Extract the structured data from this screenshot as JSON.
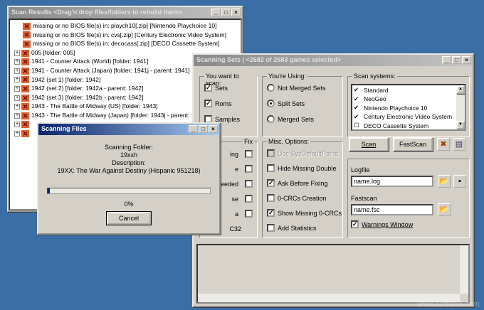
{
  "scan_results": {
    "title": "Scan Results <Drag'n'drop files/folders to rebuild them>",
    "rows": [
      {
        "text": "missing or no BIOS file(s) in: playch10[.zip] [Nintendo Playchoice 10]",
        "child": true
      },
      {
        "text": "missing or no BIOS file(s) in: cvs[.zip] [Century Electronic Video System]",
        "child": true
      },
      {
        "text": "missing or no BIOS file(s) in: decocass[.zip] [DECO Cassette System]",
        "child": true
      },
      {
        "text": "005 [folder: 005]",
        "child": false
      },
      {
        "text": "1941 - Counter Attack (World) [folder: 1941]",
        "child": false
      },
      {
        "text": "1941 - Counter Attack (Japan) [folder: 1941j - parent: 1941]",
        "child": false
      },
      {
        "text": "1942 (set 1) [folder: 1942]",
        "child": false
      },
      {
        "text": "1942 (set 2) [folder: 1942a - parent: 1942]",
        "child": false
      },
      {
        "text": "1942 (set 3) [folder: 1942b - parent: 1942]",
        "child": false
      },
      {
        "text": "1943 - The Battle of Midway (US) [folder: 1943]",
        "child": false
      },
      {
        "text": "1943 - The Battle of Midway (Japan) [folder: 1943j - parent: 1943]",
        "child": false
      }
    ]
  },
  "scanning_sets": {
    "title": "Scanning Sets | <2682 of 2683 games selected>",
    "want_label": "You want to scan:",
    "want": [
      {
        "label": "Sets",
        "checked": true
      },
      {
        "label": "Roms",
        "checked": true
      },
      {
        "label": "Samples",
        "checked": false
      }
    ],
    "using_label": "You're Using:",
    "using": [
      {
        "label": "Not Merged Sets",
        "selected": false
      },
      {
        "label": "Split Sets",
        "selected": true
      },
      {
        "label": "Merged Sets",
        "selected": false
      }
    ],
    "systems_label": "Scan systems:",
    "systems": [
      {
        "label": "Standard",
        "checked": true
      },
      {
        "label": "NeoGeo",
        "checked": true
      },
      {
        "label": "Nintendo Playchoice 10",
        "checked": true
      },
      {
        "label": "Century Electronic Video System",
        "checked": true
      },
      {
        "label": "DECO Cassette System",
        "checked": false
      }
    ],
    "fix_label": "Fix",
    "fix_rows": [
      "ing",
      "e",
      "eeded",
      "se",
      "a",
      "C32"
    ],
    "misc_label": "Misc. Options:",
    "misc": [
      {
        "label": "Use SysDefaultPaths",
        "checked": false,
        "disabled": true
      },
      {
        "label": "Hide Missing Double",
        "checked": false
      },
      {
        "label": "Ask Before Fixing",
        "checked": true
      },
      {
        "label": "0-CRCs Creation",
        "checked": false
      },
      {
        "label": "Show Missing 0-CRCs",
        "checked": true
      },
      {
        "label": "Add Statistics",
        "checked": false
      }
    ],
    "scan_button": "Scan",
    "fastscan_button": "FastScan",
    "logfile_label": "Logfile",
    "logfile_value": "name.log",
    "fastscan_label": "Fastscan",
    "fastscan_value": "name.fsc",
    "warnings_label": "Warnings Window",
    "warnings_checked": true
  },
  "scanning_files": {
    "title": "Scanning Files",
    "folder_label": "Scanning Folder:",
    "folder": "19xxh",
    "desc_label": "Description:",
    "desc": "19XX: The War Against Destiny (Hispanic 951218)",
    "progress_percent": 0,
    "progress_text": "0%",
    "cancel": "Cancel"
  },
  "watermark": "www.softonic.com"
}
